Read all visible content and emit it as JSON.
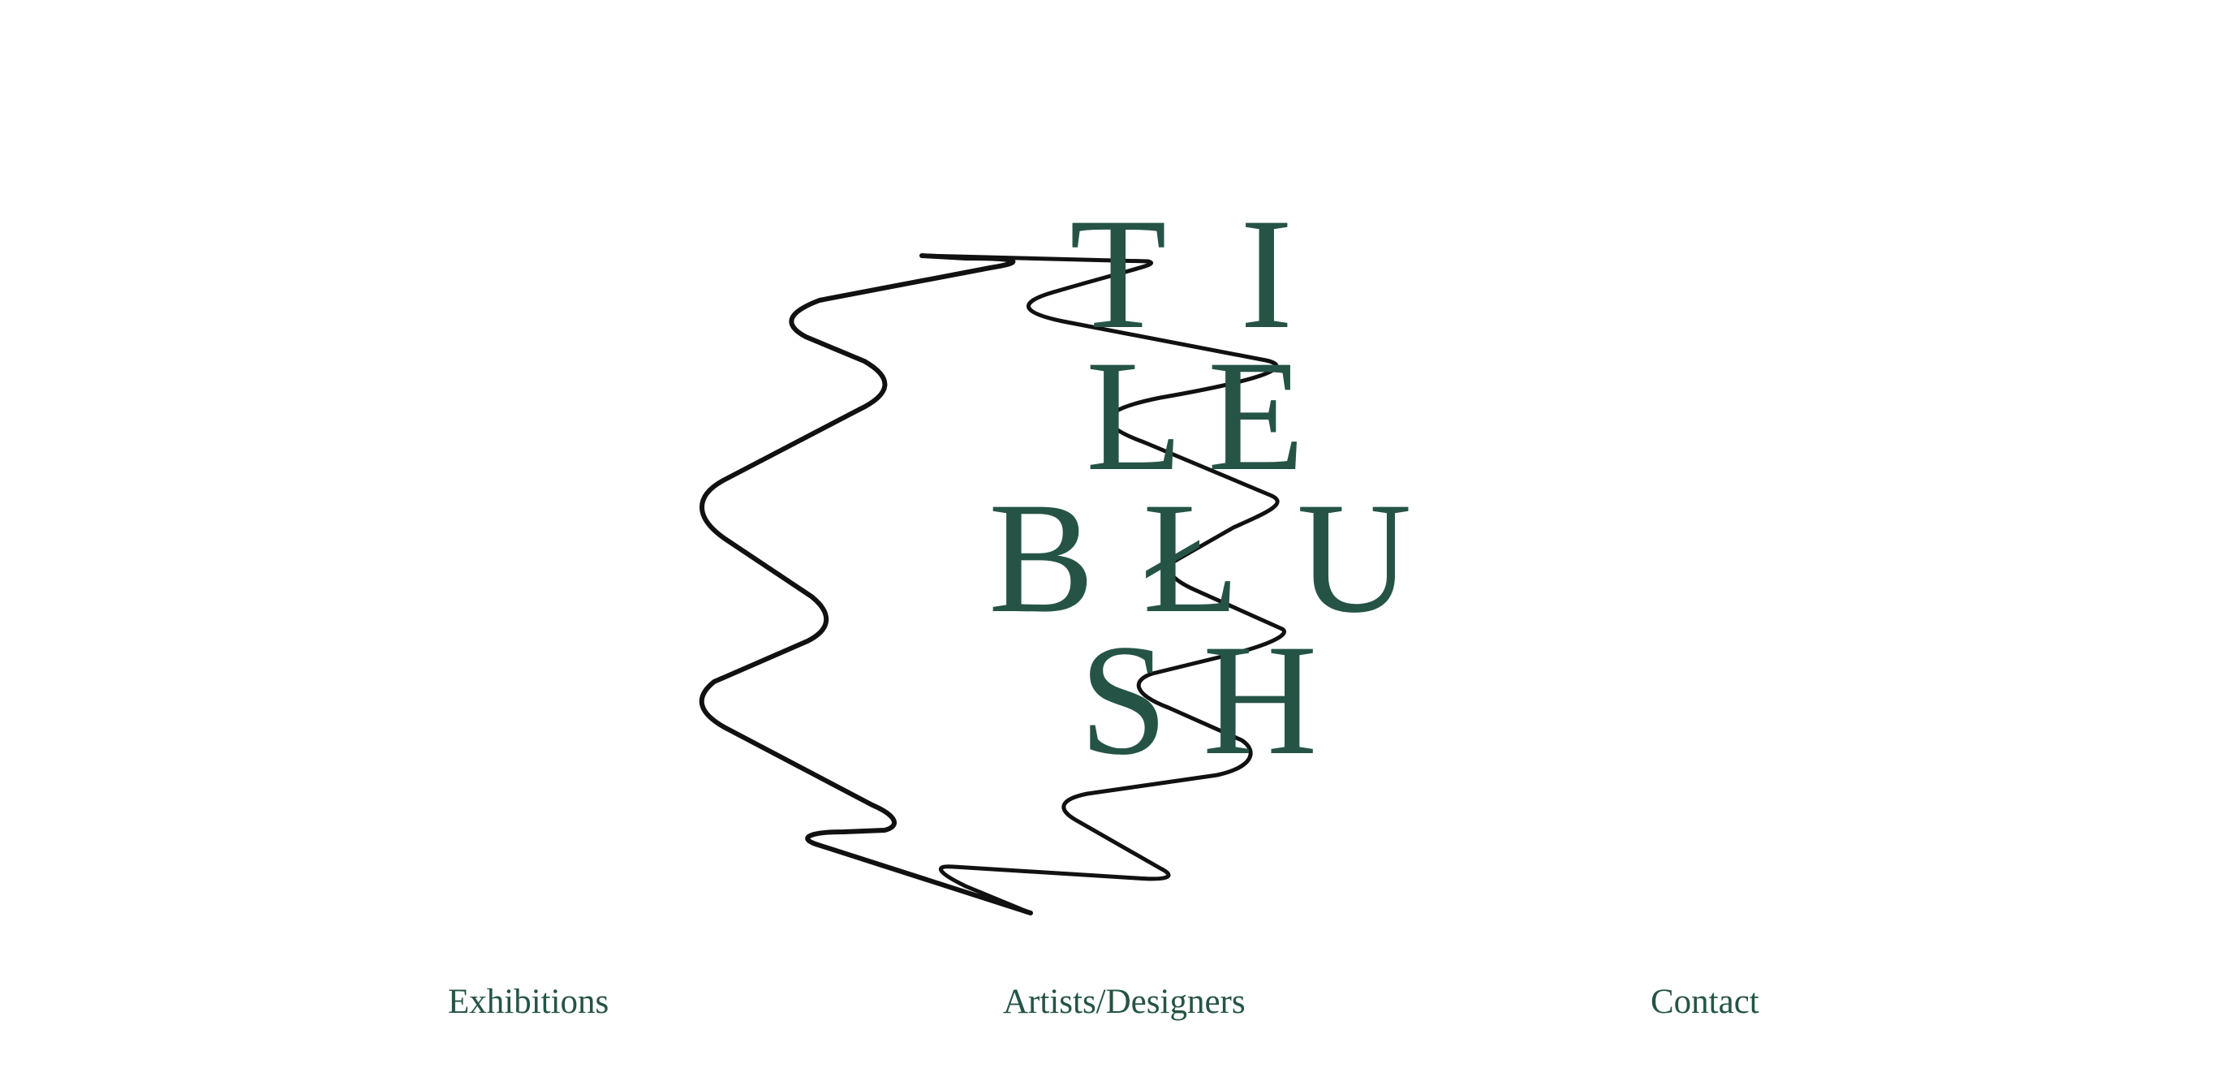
{
  "logo": {
    "letters": [
      "T",
      "I",
      "L",
      "E",
      "B",
      "Ł",
      "U",
      "S",
      "H"
    ],
    "color": "#255447"
  },
  "scribble": {
    "icon": "wavy-scribble-drawing",
    "stroke_color": "#111111"
  },
  "nav": {
    "items": [
      {
        "label": "Exhibitions"
      },
      {
        "label": "Artists/Designers"
      },
      {
        "label": "Contact"
      }
    ],
    "color": "#255447"
  },
  "colors": {
    "background": "#ffffff",
    "brand_green": "#255447"
  }
}
